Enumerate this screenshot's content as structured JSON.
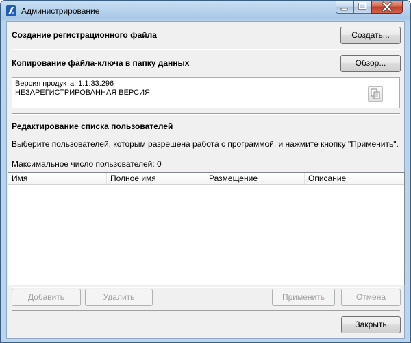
{
  "window": {
    "title": "Администрирование",
    "caption_buttons": {
      "minimize_icon": "minimize-icon",
      "maximize_icon": "maximize-icon",
      "close_icon": "close-icon"
    }
  },
  "registration": {
    "title": "Создание регистрационного файла",
    "create_button": "Создать..."
  },
  "key_copy": {
    "title": "Копирование файла-ключа в папку данных",
    "browse_button": "Обзор...",
    "version_line": "Версия продукта: 1.1.33.296",
    "status_line": "НЕЗАРЕГИСТРИРОВАННАЯ ВЕРСИЯ",
    "copy_icon": "copy-icon"
  },
  "users": {
    "title": "Редактирование списка пользователей",
    "instruction": "Выберите пользователей, которым разрешена работа с программой, и нажмите кнопку \"Применить\".",
    "max_users": "Максимальное число пользователей: 0",
    "columns": [
      "Имя",
      "Полное имя",
      "Размещение",
      "Описание"
    ],
    "rows": [],
    "add_button": "Добавить",
    "delete_button": "Удалить",
    "apply_button": "Применить",
    "cancel_button": "Отмена"
  },
  "footer": {
    "close_button": "Закрыть"
  },
  "colors": {
    "titlebar": "#bcd5ee",
    "client_bg": "#f0f0f0",
    "close_red": "#c2402a"
  }
}
